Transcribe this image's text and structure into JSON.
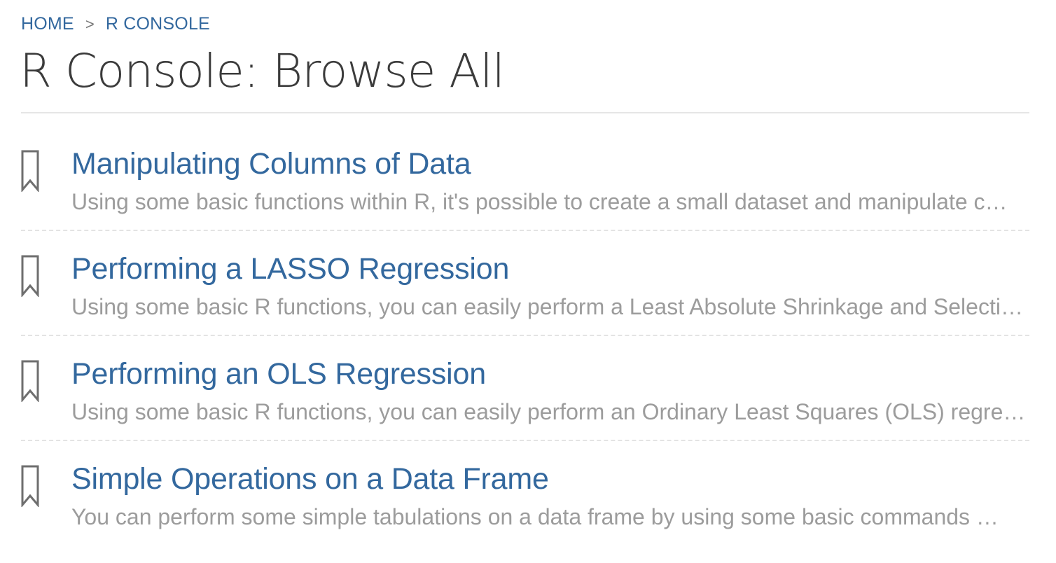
{
  "breadcrumb": {
    "home": "HOME",
    "separator": ">",
    "current": "R CONSOLE"
  },
  "page_title": "R Console: Browse All",
  "colors": {
    "link": "#33689e",
    "title": "#3b3b3b",
    "description": "#9c9c9c",
    "divider": "#e3e3e3",
    "icon": "#6e6e6e"
  },
  "entries": [
    {
      "icon": "bookmark-icon",
      "title": "Manipulating Columns of Data",
      "description": "Using some basic functions within R, it's possible to create a small dataset and manipulate c…"
    },
    {
      "icon": "bookmark-icon",
      "title": "Performing a LASSO Regression",
      "description": "Using some basic R functions, you can easily perform a Least Absolute Shrinkage and Selecti…"
    },
    {
      "icon": "bookmark-icon",
      "title": "Performing an OLS Regression",
      "description": "Using some basic R functions, you can easily perform an Ordinary Least Squares (OLS) regres…"
    },
    {
      "icon": "bookmark-icon",
      "title": "Simple Operations on a Data Frame",
      "description": "You can perform some simple tabulations on a data frame by using some basic commands …"
    }
  ]
}
